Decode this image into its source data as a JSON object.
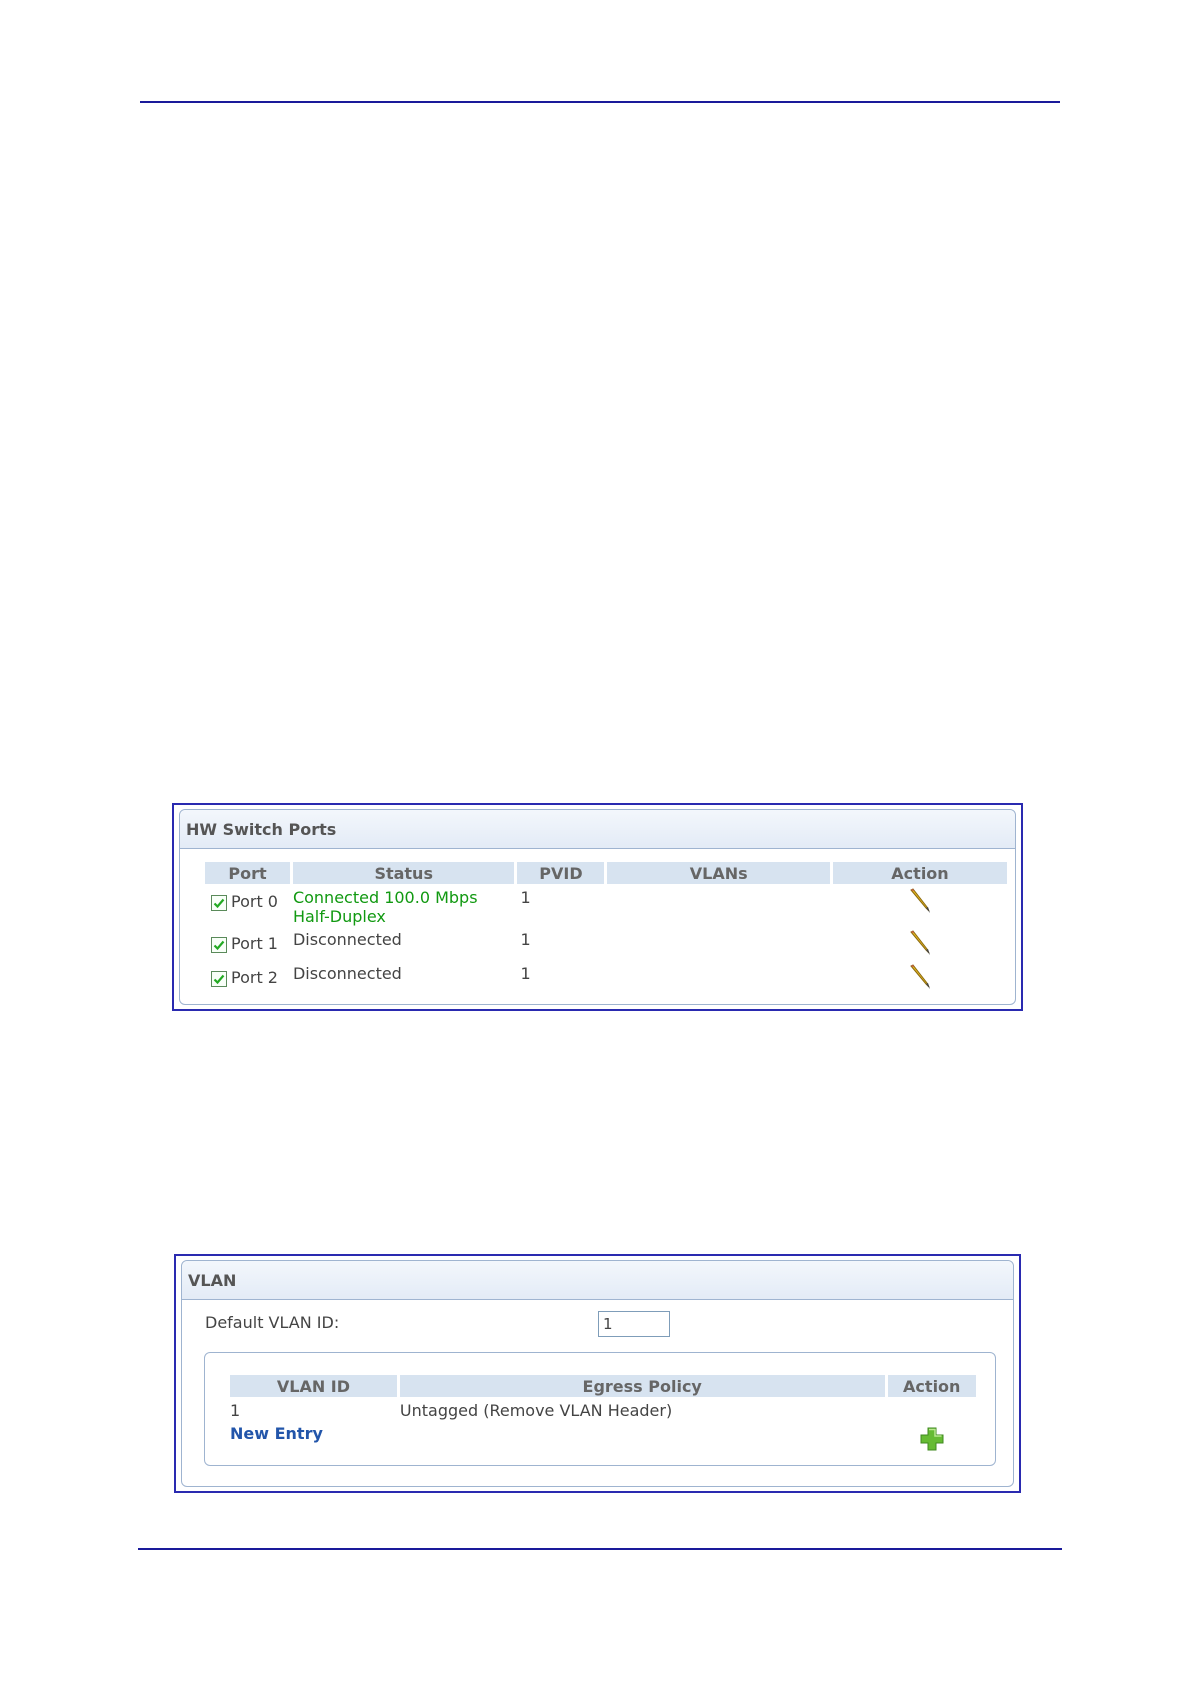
{
  "hw_switch_ports": {
    "title": "HW Switch Ports",
    "columns": [
      "Port",
      "Status",
      "PVID",
      "VLANs",
      "Action"
    ],
    "rows": [
      {
        "checked": true,
        "port": "Port 0",
        "status_line1": "Connected 100.0 Mbps",
        "status_line2": "Half-Duplex",
        "status_color": "#119911",
        "pvid": "1",
        "vlans": "",
        "action_icon": "pencil-icon"
      },
      {
        "checked": true,
        "port": "Port 1",
        "status_line1": "Disconnected",
        "status_line2": "",
        "pvid": "1",
        "vlans": "",
        "action_icon": "pencil-icon"
      },
      {
        "checked": true,
        "port": "Port 2",
        "status_line1": "Disconnected",
        "status_line2": "",
        "pvid": "1",
        "vlans": "",
        "action_icon": "pencil-icon"
      }
    ]
  },
  "vlan": {
    "title": "VLAN",
    "default_vlan_label": "Default VLAN ID:",
    "default_vlan_value": "1",
    "columns": [
      "VLAN ID",
      "Egress Policy",
      "Action"
    ],
    "rows": [
      {
        "vlan_id": "1",
        "egress_policy": "Untagged (Remove VLAN Header)"
      }
    ],
    "new_entry_label": "New Entry",
    "add_icon": "plus-icon"
  }
}
